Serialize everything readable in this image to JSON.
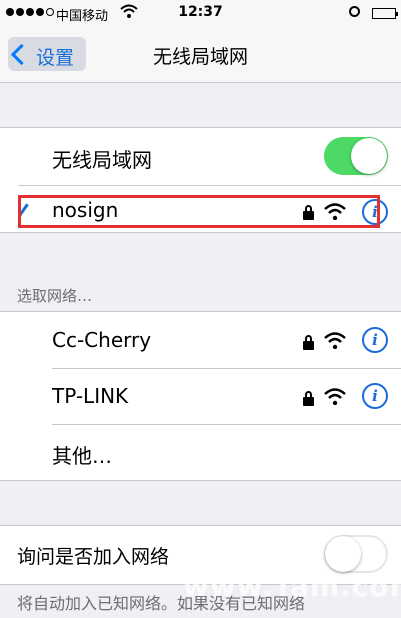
{
  "status_bar": {
    "carrier": "中国移动",
    "time": "12:37",
    "signal_bars_filled": 4,
    "signal_bars_total": 5
  },
  "nav": {
    "back_label": "设置",
    "title": "无线局域网"
  },
  "wifi_toggle": {
    "label": "无线局域网",
    "on": true
  },
  "connected_network": {
    "name": "nosign",
    "secured": true,
    "selected": true
  },
  "section_header": "选取网络…",
  "networks": [
    {
      "name": "Cc-Cherry",
      "secured": true
    },
    {
      "name": "TP-LINK",
      "secured": true
    }
  ],
  "other_label": "其他…",
  "ask_to_join": {
    "label": "询问是否加入网络",
    "on": false
  },
  "footer_text": "将自动加入已知网络。如果没有已知网络",
  "watermark": "www.Tam.com",
  "colors": {
    "accent": "#1a6dd6",
    "toggle_on": "#4cd964",
    "highlight": "#e0302f"
  }
}
